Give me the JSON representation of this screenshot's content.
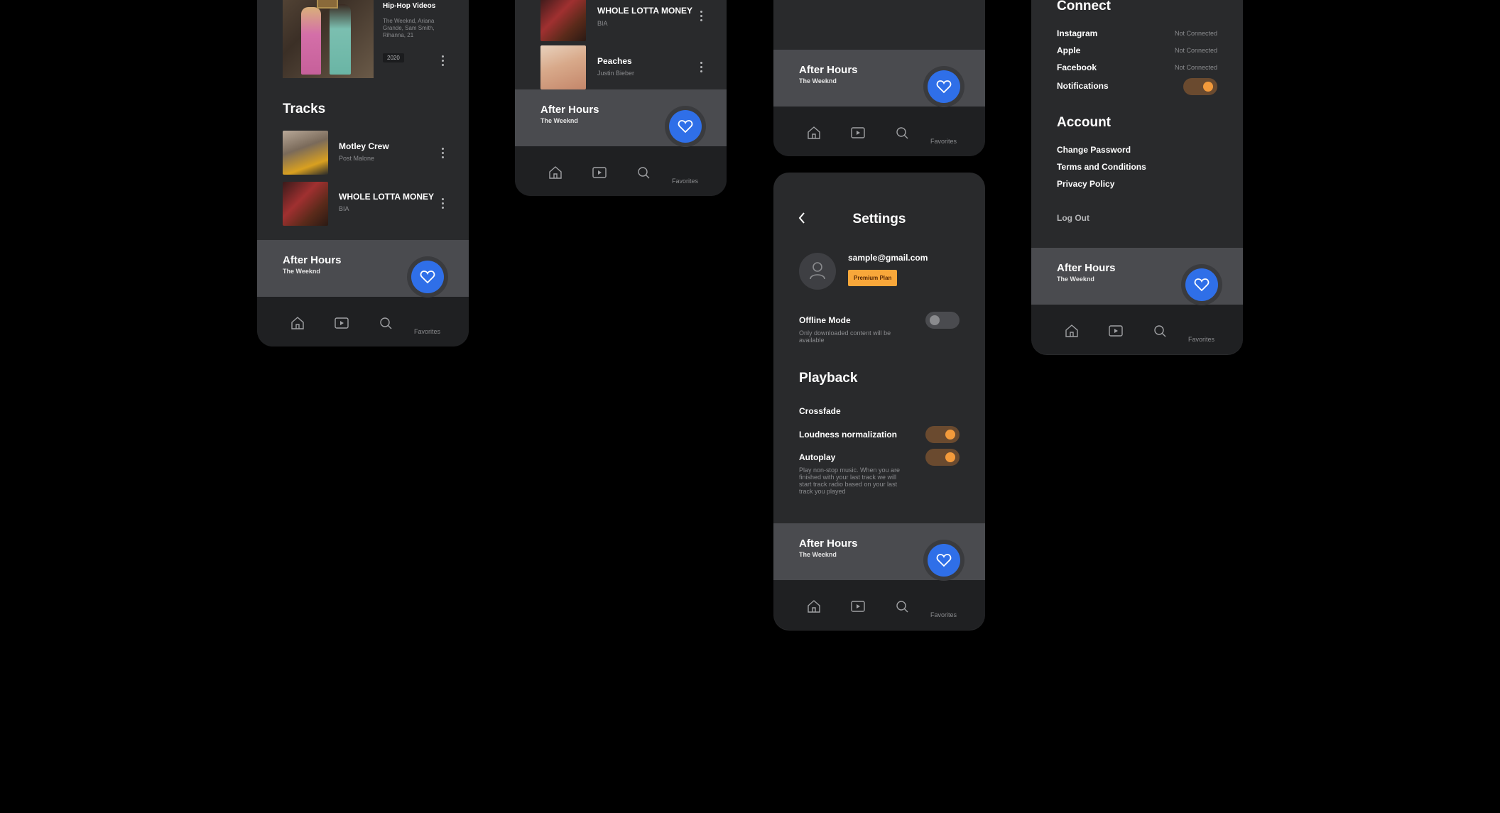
{
  "colors": {
    "accent_blue": "#2f6fe8",
    "accent_orange": "#f39a3b",
    "panel": "#292a2c",
    "player": "#4a4b4f"
  },
  "nav": {
    "favorites_label": "Favorites",
    "icons": [
      "home-icon",
      "video-icon",
      "search-icon",
      "heart-icon"
    ]
  },
  "player": {
    "title": "After Hours",
    "artist": "The Weeknd"
  },
  "screen1": {
    "video": {
      "title": "Hip-Hop Videos",
      "description": "The Weeknd, Ariana Grande, Sam Smith, Rihanna, 21",
      "year": "2020"
    },
    "tracks_heading": "Tracks",
    "tracks": [
      {
        "title": "Motley Crew",
        "artist": "Post Malone"
      },
      {
        "title": "WHOLE LOTTA MONEY",
        "artist": "BIA"
      }
    ]
  },
  "screen2": {
    "tracks": [
      {
        "title": "WHOLE LOTTA MONEY",
        "artist": "BIA"
      },
      {
        "title": "Peaches",
        "artist": "Justin Bieber"
      }
    ]
  },
  "settings": {
    "title": "Settings",
    "email": "sample@gmail.com",
    "plan": "Premium Plan",
    "offline_mode": {
      "label": "Offline Mode",
      "desc": "Only downloaded content will be available",
      "on": false
    },
    "playback_heading": "Playback",
    "crossfade": "Crossfade",
    "loudness": {
      "label": "Loudness normalization",
      "on": true
    },
    "autoplay": {
      "label": "Autoplay",
      "desc": "Play non-stop music. When you are finished with your last track we will start track radio based on your last track you played",
      "on": true
    }
  },
  "connect": {
    "heading": "Connect",
    "items": [
      {
        "label": "Instagram",
        "status": "Not Connected"
      },
      {
        "label": "Apple",
        "status": "Not Connected"
      },
      {
        "label": "Facebook",
        "status": "Not Connected"
      }
    ],
    "notifications": {
      "label": "Notifications",
      "on": true
    }
  },
  "account": {
    "heading": "Account",
    "items": [
      "Change Password",
      "Terms and Conditions",
      "Privacy Policy"
    ],
    "logout": "Log Out"
  }
}
